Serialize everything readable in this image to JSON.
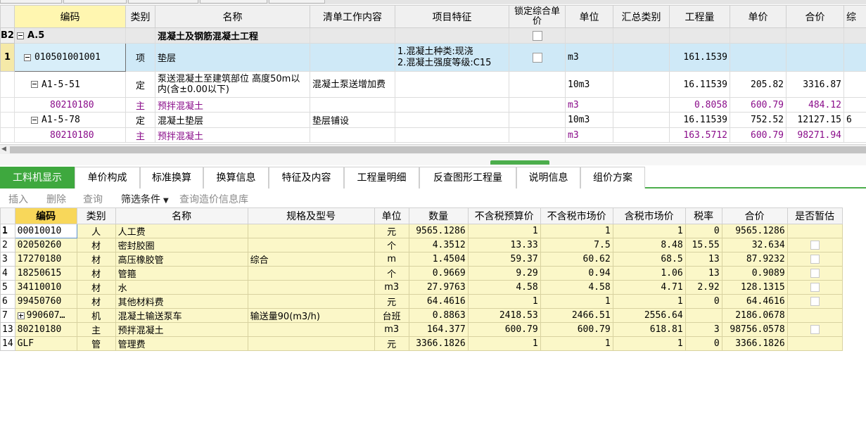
{
  "colors": {
    "accent_green": "#3ea83e",
    "selected_row": "#cfe9f7",
    "material_row": "#fbf7c8",
    "main_material_text": "#8a0c8a"
  },
  "top_grid": {
    "headers": [
      "编码",
      "类别",
      "名称",
      "清单工作内容",
      "项目特征",
      "锁定综合单价",
      "单位",
      "汇总类别",
      "工程量",
      "单价",
      "合价",
      "综"
    ],
    "section": {
      "rownum": "B2",
      "code": "A.5",
      "name": "混凝土及钢筋混凝土工程"
    },
    "item": {
      "rownum": "1",
      "code": "010501001001",
      "type": "项",
      "name": "垫层",
      "feature1": "1.混凝土种类:现浇",
      "feature2": "2.混凝土强度等级:C15",
      "unit": "m3",
      "quantity": "161.1539"
    },
    "rows": [
      {
        "code": "A1-5-51",
        "type": "定",
        "name": "泵送混凝土至建筑部位 高度50m以内(含±0.00以下)",
        "work": "混凝土泵送增加费",
        "unit": "10m3",
        "quantity": "16.11539",
        "price": "205.82",
        "total": "3316.87"
      },
      {
        "code": "80210180",
        "type": "主",
        "name": "预拌混凝土",
        "work": "",
        "unit": "m3",
        "quantity": "0.8058",
        "price": "600.79",
        "total": "484.12"
      },
      {
        "code": "A1-5-78",
        "type": "定",
        "name": "混凝土垫层",
        "work": "垫层铺设",
        "unit": "10m3",
        "quantity": "16.11539",
        "price": "752.52",
        "total": "12127.15",
        "extra": "6"
      },
      {
        "code": "80210180",
        "type": "主",
        "name": "预拌混凝土",
        "work": "",
        "unit": "m3",
        "quantity": "163.5712",
        "price": "600.79",
        "total": "98271.94"
      }
    ]
  },
  "tabs": [
    "工料机显示",
    "单价构成",
    "标准换算",
    "换算信息",
    "特征及内容",
    "工程量明细",
    "反查图形工程量",
    "说明信息",
    "组价方案"
  ],
  "toolbar": {
    "insert": "插入",
    "delete": "删除",
    "query": "查询",
    "filter": "筛选条件",
    "price_db": "查询造价信息库"
  },
  "bottom_grid": {
    "headers": [
      "编码",
      "类别",
      "名称",
      "规格及型号",
      "单位",
      "数量",
      "不含税预算价",
      "不含税市场价",
      "含税市场价",
      "税率",
      "合价",
      "是否暂估"
    ],
    "rows": [
      {
        "rn": "1",
        "code": "00010010",
        "type": "人",
        "name": "人工费",
        "spec": "",
        "unit": "元",
        "qty": "9565.1286",
        "budget": "1",
        "market": "1",
        "taxed": "1",
        "rate": "0",
        "total": "9565.1286",
        "check": false
      },
      {
        "rn": "2",
        "code": "02050260",
        "type": "材",
        "name": "密封胶圈",
        "spec": "",
        "unit": "个",
        "qty": "4.3512",
        "budget": "13.33",
        "market": "7.5",
        "taxed": "8.48",
        "rate": "15.55",
        "total": "32.634",
        "check": true
      },
      {
        "rn": "3",
        "code": "17270180",
        "type": "材",
        "name": "高压橡胶管",
        "spec": "综合",
        "unit": "m",
        "qty": "1.4504",
        "budget": "59.37",
        "market": "60.62",
        "taxed": "68.5",
        "rate": "13",
        "total": "87.9232",
        "check": true
      },
      {
        "rn": "4",
        "code": "18250615",
        "type": "材",
        "name": "管箍",
        "spec": "",
        "unit": "个",
        "qty": "0.9669",
        "budget": "9.29",
        "market": "0.94",
        "taxed": "1.06",
        "rate": "13",
        "total": "0.9089",
        "check": true
      },
      {
        "rn": "5",
        "code": "34110010",
        "type": "材",
        "name": "水",
        "spec": "",
        "unit": "m3",
        "qty": "27.9763",
        "budget": "4.58",
        "market": "4.58",
        "taxed": "4.71",
        "rate": "2.92",
        "total": "128.1315",
        "check": true
      },
      {
        "rn": "6",
        "code": "99450760",
        "type": "材",
        "name": "其他材料费",
        "spec": "",
        "unit": "元",
        "qty": "64.4616",
        "budget": "1",
        "market": "1",
        "taxed": "1",
        "rate": "0",
        "total": "64.4616",
        "check": true
      },
      {
        "rn": "7",
        "code": "990607…",
        "type": "机",
        "name": "混凝土输送泵车",
        "spec": "输送量90(m3/h)",
        "unit": "台班",
        "qty": "0.8863",
        "budget": "2418.53",
        "market": "2466.51",
        "taxed": "2556.64",
        "rate": "",
        "total": "2186.0678",
        "check": false
      },
      {
        "rn": "13",
        "code": "80210180",
        "type": "主",
        "name": "预拌混凝土",
        "spec": "",
        "unit": "m3",
        "qty": "164.377",
        "budget": "600.79",
        "market": "600.79",
        "taxed": "618.81",
        "rate": "3",
        "total": "98756.0578",
        "check": true
      },
      {
        "rn": "14",
        "code": "GLF",
        "type": "管",
        "name": "管理费",
        "spec": "",
        "unit": "元",
        "qty": "3366.1826",
        "budget": "1",
        "market": "1",
        "taxed": "1",
        "rate": "0",
        "total": "3366.1826",
        "check": false
      }
    ]
  }
}
